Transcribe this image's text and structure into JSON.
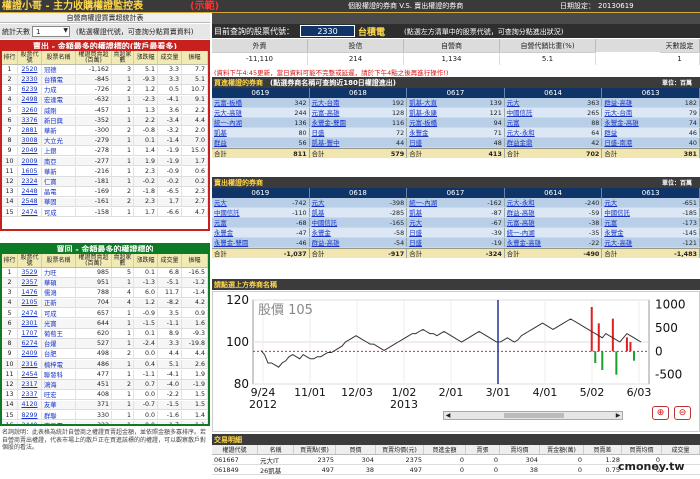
{
  "header": {
    "title": "權證小哥 - 主力收購權證監控表",
    "subtitle": "(示範)",
    "right_title": "個股權證的券商 V.S. 賣出權證的券商",
    "date_label": "日期設定：",
    "date_value": "20130619"
  },
  "left": {
    "notice": "自營商權證買賣超統計表",
    "stat_days_label": "統計天數",
    "stat_days_value": "1",
    "note": "(點選權證代號，可查詢分點買賣資料)",
    "sell_title": "賣出 - 金額最多的權證標的(散戶最看多)",
    "buy_title": "買回 - 金額最多的權證標的",
    "columns": [
      "排行",
      "股票代號",
      "股票名稱",
      "權證買賣超(百萬)",
      "賣超家數",
      "漲跌幅",
      "成交量",
      "振幅"
    ],
    "sell_rows": [
      [
        "1",
        "2520",
        "冠德",
        "-1,162",
        "3",
        "5.1",
        "3.3",
        "7.7"
      ],
      [
        "2",
        "2330",
        "台積電",
        "-845",
        "1",
        "-9.3",
        "3.3",
        "5.1"
      ],
      [
        "3",
        "6239",
        "力成",
        "-726",
        "2",
        "1.2",
        "0.5",
        "10.7"
      ],
      [
        "4",
        "2498",
        "宏達電",
        "-632",
        "1",
        "-2.3",
        "-4.1",
        "9.1"
      ],
      [
        "5",
        "3260",
        "威剛",
        "-457",
        "1",
        "1.3",
        "3.6",
        "2.2"
      ],
      [
        "6",
        "3376",
        "新日興",
        "-352",
        "1",
        "2.2",
        "-3.4",
        "4.4"
      ],
      [
        "7",
        "2881",
        "華新",
        "-300",
        "2",
        "-0.8",
        "-3.2",
        "2.0"
      ],
      [
        "8",
        "3008",
        "大立光",
        "-279",
        "1",
        "0.1",
        "-1.4",
        "7.0"
      ],
      [
        "9",
        "2049",
        "上銀",
        "-278",
        "1",
        "1.4",
        "-1.9",
        "15.0"
      ],
      [
        "10",
        "2009",
        "南亞",
        "-277",
        "1",
        "1.9",
        "-1.9",
        "1.7"
      ],
      [
        "11",
        "1605",
        "華新",
        "-216",
        "1",
        "2.3",
        "-0.9",
        "0.6"
      ],
      [
        "12",
        "2324",
        "仁寶",
        "-181",
        "1",
        "-0.2",
        "-0.2",
        "0.2"
      ],
      [
        "13",
        "2448",
        "晶電",
        "-169",
        "2",
        "-1.8",
        "-6.5",
        "2.3"
      ],
      [
        "14",
        "2548",
        "華固",
        "-161",
        "2",
        "2.3",
        "1.7",
        "2.7"
      ],
      [
        "15",
        "2474",
        "可成",
        "-158",
        "1",
        "1.7",
        "-6.6",
        "4.7"
      ]
    ],
    "buy_rows": [
      [
        "1",
        "3529",
        "力旺",
        "985",
        "5",
        "0.1",
        "6.8",
        "-16.5"
      ],
      [
        "2",
        "2357",
        "華碩",
        "951",
        "1",
        "-1.3",
        "-5.1",
        "-1.2"
      ],
      [
        "3",
        "1476",
        "儒鴻",
        "788",
        "4",
        "6.0",
        "11.7",
        "-1.4"
      ],
      [
        "4",
        "2105",
        "正新",
        "704",
        "4",
        "1.2",
        "-8.2",
        "4.2"
      ],
      [
        "5",
        "2474",
        "可成",
        "657",
        "1",
        "-0.9",
        "3.5",
        "0.9"
      ],
      [
        "6",
        "2301",
        "光寶",
        "644",
        "1",
        "-1.5",
        "-1.1",
        "1.6"
      ],
      [
        "7",
        "1707",
        "葡萄王",
        "620",
        "1",
        "0.1",
        "8.9",
        "-9.3"
      ],
      [
        "8",
        "6274",
        "台燿",
        "527",
        "1",
        "-2.4",
        "3.3",
        "-19.8"
      ],
      [
        "9",
        "2409",
        "台肥",
        "498",
        "2",
        "0.0",
        "4.4",
        "4.4"
      ],
      [
        "10",
        "2316",
        "楠梓電",
        "486",
        "1",
        "0.4",
        "5.1",
        "2.6"
      ],
      [
        "11",
        "2454",
        "聯發科",
        "477",
        "1",
        "-1.1",
        "-4.1",
        "1.9"
      ],
      [
        "12",
        "2317",
        "鴻海",
        "451",
        "2",
        "0.7",
        "-4.0",
        "-1.9"
      ],
      [
        "13",
        "2337",
        "旺宏",
        "408",
        "1",
        "0.0",
        "-2.2",
        "1.5"
      ],
      [
        "14",
        "4120",
        "友華",
        "371",
        "1",
        "-0.7",
        "-1.5",
        "1.5"
      ],
      [
        "15",
        "8299",
        "群聯",
        "330",
        "1",
        "0.0",
        "-1.6",
        "1.4"
      ],
      [
        "16",
        "2449",
        "京元電",
        "322",
        "1",
        "0.0",
        "-1.7",
        "1.1"
      ]
    ],
    "footnote": "名詞說明：此表格為統計自營商之權證買賣超金額，並依照金額多寡排序。若自營商賣出權證，代表市場上的散戶正在買進該標的的權證，可以觀察散戶對個股的看法。"
  },
  "right": {
    "stock_label": "目前查詢的股票代號：",
    "stock_value": "2330",
    "stock_name": "台積電",
    "stock_note": "(點選左方清單中的股票代號，可查詢分點進出狀況)",
    "summary_headers": [
      "外資",
      "投信",
      "自營商",
      "自營代銷比重(%)",
      "天數設定"
    ],
    "summary_values": [
      "-11,110",
      "214",
      "1,134",
      "5.1",
      "1"
    ],
    "warn_note": "(資料下午4:45更新，當日資料可能不完整或延遲，請於下午4點之後再進行操作!)",
    "buy_section_title": "買進權證的券商",
    "buy_section_note": "(點選券商名稱可查詢近180日權證進出)",
    "unit": "單位：百萬",
    "dates": [
      "0619",
      "0618",
      "0617",
      "0614",
      "0613"
    ],
    "buy_grid": [
      [
        [
          "元富-板橋",
          "342"
        ],
        [
          "元大-台南",
          "192"
        ],
        [
          "凱基-大直",
          "139"
        ],
        [
          "元大",
          "363"
        ],
        [
          "群益-高雄",
          "182"
        ]
      ],
      [
        [
          "元大-高雄",
          "244"
        ],
        [
          "元富-高雄",
          "128"
        ],
        [
          "凱基-永康",
          "121"
        ],
        [
          "中國信託",
          "265"
        ],
        [
          "元大-台南",
          "79"
        ]
      ],
      [
        [
          "統一-內湖",
          "136"
        ],
        [
          "永豐金-雙園",
          "116"
        ],
        [
          "元富-板橋",
          "94"
        ],
        [
          "元富",
          "88"
        ],
        [
          "永豐金-高雄",
          "74"
        ]
      ],
      [
        [
          "凱基",
          "80"
        ],
        [
          "日盛",
          "72"
        ],
        [
          "永豐金",
          "71"
        ],
        [
          "元大-永和",
          "64"
        ],
        [
          "群益",
          "46"
        ]
      ],
      [
        [
          "群益",
          "56"
        ],
        [
          "凱基-豐中",
          "44"
        ],
        [
          "日盛",
          "48"
        ],
        [
          "群益金鼎",
          "42"
        ],
        [
          "日盛-南港",
          "40"
        ]
      ]
    ],
    "buy_totals": [
      "811",
      "579",
      "413",
      "702",
      "381"
    ],
    "sell_section_title": "賣出權證的券商",
    "sell_grid": [
      [
        [
          "元大",
          "-742"
        ],
        [
          "元大",
          "-398"
        ],
        [
          "統一-內湖",
          "-162"
        ],
        [
          "元大-永和",
          "-240"
        ],
        [
          "元大",
          "-651"
        ]
      ],
      [
        [
          "中國信託",
          "-110"
        ],
        [
          "凱基",
          "-285"
        ],
        [
          "凱基",
          "-87"
        ],
        [
          "群益-高雄",
          "-59"
        ],
        [
          "中國信託",
          "-185"
        ]
      ],
      [
        [
          "元富",
          "-68"
        ],
        [
          "中國信託",
          "-165"
        ],
        [
          "元大",
          "-67"
        ],
        [
          "元富-高雄",
          "-38"
        ],
        [
          "元富",
          "-173"
        ]
      ],
      [
        [
          "永豐金",
          "-47"
        ],
        [
          "永豐金",
          "-58"
        ],
        [
          "日盛",
          "-39"
        ],
        [
          "統一-內湖",
          "-35"
        ],
        [
          "永豐金",
          "-145"
        ]
      ],
      [
        [
          "永豐金-雙園",
          "-46"
        ],
        [
          "群益-高雄",
          "-54"
        ],
        [
          "日盛",
          "-19"
        ],
        [
          "永豐金-高雄",
          "-22"
        ],
        [
          "元大-高雄",
          "-121"
        ]
      ]
    ],
    "sell_totals": [
      "-1,037",
      "-917",
      "-324",
      "-490",
      "-1,483"
    ],
    "total_label": "合計",
    "chart_note": "請點選上方券商名稱",
    "trade_title": "交易明細",
    "trade_headers": [
      "權證代號",
      "名稱",
      "買賣點(張)",
      "買價",
      "買賣均價(元)",
      "買進金額",
      "賣張",
      "賣均價",
      "賣金額(萬)",
      "買賣差",
      "買賣均價",
      "成交量"
    ],
    "trades": [
      [
        "061667",
        "元大IT",
        "2375",
        "304",
        "2375",
        "0",
        "0",
        "304",
        "0",
        "1.28",
        "0"
      ],
      [
        "061849",
        "26凱基",
        "497",
        "38",
        "497",
        "0",
        "0",
        "38",
        "0",
        "0.75",
        "0"
      ]
    ],
    "watermark": "cmoney.tw"
  },
  "chart_data": {
    "type": "line",
    "title": "",
    "legend": "股價 105",
    "x": [
      "9/24",
      "11/01",
      "12/03",
      "1/02",
      "2/01",
      "3/01",
      "4/01",
      "5/02",
      "6/03"
    ],
    "x_year_labels": [
      {
        "at": "9/24",
        "label": "2012"
      },
      {
        "at": "1/02",
        "label": "2013"
      }
    ],
    "ylim": [
      80,
      120
    ],
    "y_ticks": [
      80,
      100,
      120
    ],
    "y2lim": [
      -700,
      1100
    ],
    "y2_ticks": [
      -500,
      0,
      500,
      1000
    ],
    "series": [
      {
        "values": [
          96,
          94,
          90,
          90,
          89,
          88,
          90,
          91,
          93,
          94,
          93,
          92,
          94,
          93,
          92,
          92,
          93,
          93,
          94,
          95,
          95,
          96,
          97,
          98,
          100,
          101,
          102,
          103,
          102,
          101,
          100,
          99,
          99,
          98,
          97,
          96,
          97,
          98,
          99,
          100,
          101,
          102,
          103,
          104,
          104,
          105,
          106,
          105,
          104,
          104,
          103,
          104,
          105,
          104,
          103,
          102,
          101,
          100,
          101,
          102,
          103,
          104,
          105,
          104,
          103,
          102,
          101,
          100,
          100,
          101,
          102,
          101,
          100,
          101,
          103,
          104,
          105,
          106,
          107,
          108,
          109,
          108,
          107,
          106,
          107,
          108,
          109,
          110,
          111,
          110,
          109,
          108,
          107,
          106,
          105,
          104,
          103,
          102,
          104,
          103,
          102,
          101,
          100,
          102,
          104,
          103,
          102,
          101,
          100
        ]
      },
      {
        "values": [
          0,
          0,
          0,
          0,
          0,
          0,
          0,
          0,
          0,
          0,
          0,
          0,
          0,
          0,
          0,
          0,
          0,
          0,
          0,
          0,
          0,
          0,
          0,
          0,
          0,
          0,
          0,
          0,
          0,
          0,
          0,
          0,
          0,
          0,
          0,
          0,
          0,
          0,
          0,
          0,
          0,
          0,
          0,
          0,
          0,
          0,
          0,
          0,
          0,
          0,
          0,
          0,
          0,
          0,
          0,
          0,
          0,
          0,
          0,
          0,
          0,
          0,
          0,
          0,
          0,
          0,
          0,
          0,
          0,
          0,
          0,
          0,
          0,
          0,
          0,
          0,
          0,
          0,
          0,
          0,
          0,
          0,
          0,
          0,
          0,
          0,
          0,
          0,
          0,
          0,
          0,
          0,
          0,
          0,
          950,
          -250,
          600,
          -400,
          0,
          0,
          700,
          -500,
          0,
          0,
          300,
          200,
          -200,
          0,
          0
        ]
      }
    ]
  }
}
